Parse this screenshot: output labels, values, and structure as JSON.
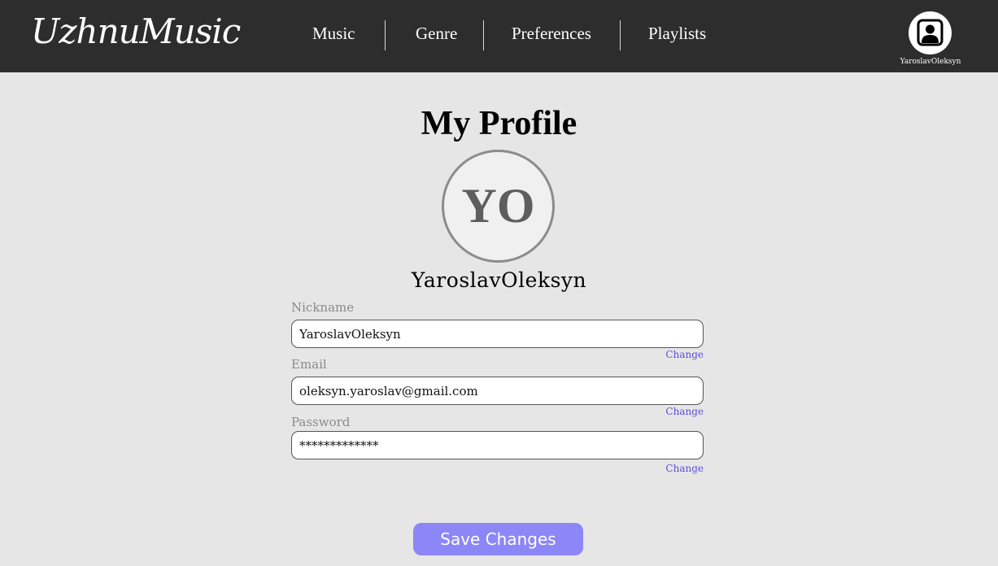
{
  "app": {
    "logo": "UzhnuMusic"
  },
  "nav": {
    "items": [
      "Music",
      "Genre",
      "Preferences",
      "Playlists"
    ]
  },
  "user": {
    "name": "YaroslavOleksyn",
    "icon": "user-portrait-icon"
  },
  "profile": {
    "title": "My Profile",
    "initials": "YO",
    "name": "YaroslavOleksyn",
    "fields": [
      {
        "label": "Nickname",
        "value": "YaroslavOleksyn",
        "change": "Change"
      },
      {
        "label": "Email",
        "value": "oleksyn.yaroslav@gmail.com",
        "change": "Change"
      },
      {
        "label": "Password",
        "value": "*************",
        "change": "Change"
      }
    ],
    "save_label": "Save Changes"
  },
  "colors": {
    "topbar": "#2d2d2d",
    "background": "#e6e6e6",
    "accent": "#8c86f6",
    "link": "#5a50d8"
  }
}
